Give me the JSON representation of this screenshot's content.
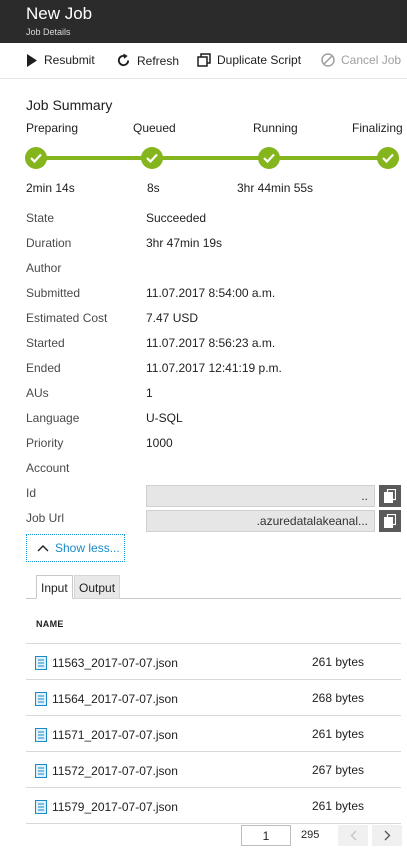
{
  "window": {
    "title": "New Job",
    "subtitle": "Job Details"
  },
  "toolbar": {
    "resubmit": "Resubmit",
    "refresh": "Refresh",
    "duplicate": "Duplicate Script",
    "cancel": "Cancel Job"
  },
  "summary": {
    "title": "Job Summary",
    "stages": [
      {
        "name": "Preparing",
        "duration": "2min 14s"
      },
      {
        "name": "Queued",
        "duration": "8s"
      },
      {
        "name": "Running",
        "duration": "3hr 44min 55s"
      },
      {
        "name": "Finalizing",
        "duration": ""
      }
    ],
    "accent": "#84b51c"
  },
  "details": [
    {
      "label": "State",
      "value": "Succeeded"
    },
    {
      "label": "Duration",
      "value": "3hr 47min 19s"
    },
    {
      "label": "Author",
      "value": ""
    },
    {
      "label": "Submitted",
      "value": "11.07.2017 8:54:00 a.m."
    },
    {
      "label": "Estimated Cost",
      "value": "7.47 USD"
    },
    {
      "label": "Started",
      "value": "11.07.2017 8:56:23 a.m."
    },
    {
      "label": "Ended",
      "value": "11.07.2017 12:41:19 p.m."
    },
    {
      "label": "AUs",
      "value": "1"
    },
    {
      "label": "Language",
      "value": "U-SQL"
    },
    {
      "label": "Priority",
      "value": "1000"
    },
    {
      "label": "Account",
      "value": ""
    },
    {
      "label": "Id",
      "value": ".."
    },
    {
      "label": "Job Url",
      "value": ".azuredatalakeanal..."
    }
  ],
  "show_less": "Show less...",
  "tabs": [
    {
      "label": "Input"
    },
    {
      "label": "Output"
    }
  ],
  "files": {
    "column_header": "NAME",
    "rows": [
      {
        "name": "11563_2017-07-07.json",
        "size": "261 bytes"
      },
      {
        "name": "11564_2017-07-07.json",
        "size": "268 bytes"
      },
      {
        "name": "11571_2017-07-07.json",
        "size": "261 bytes"
      },
      {
        "name": "11572_2017-07-07.json",
        "size": "267 bytes"
      },
      {
        "name": "11579_2017-07-07.json",
        "size": "261 bytes"
      }
    ]
  },
  "pager": {
    "current": "1",
    "total": "295"
  }
}
